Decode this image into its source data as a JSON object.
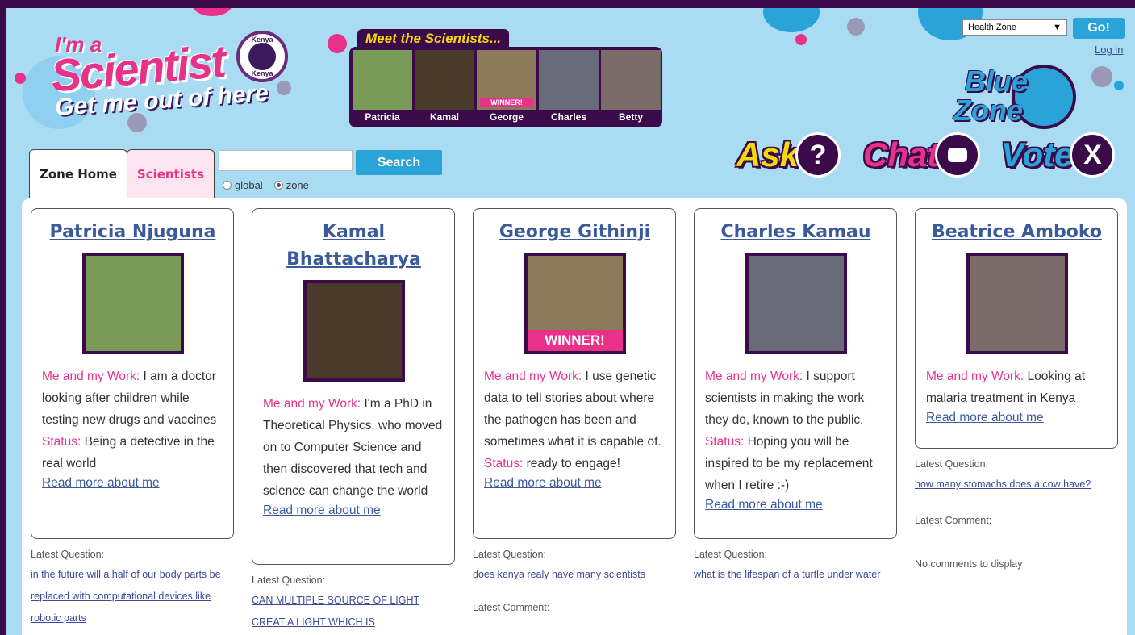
{
  "colors": {
    "accent_pink": "#e8328a",
    "accent_blue": "#2aa3d9",
    "frame_purple": "#3a0a4a",
    "link_blue": "#3a5a9a"
  },
  "header": {
    "logo": {
      "line1": "I'm a",
      "line2": "Scientist",
      "line3": "Get me out of here",
      "seal_top": "Kenya",
      "seal_bottom": "Kenya"
    },
    "meet_title": "Meet the Scientists...",
    "thumbs": [
      {
        "name": "Patricia",
        "color": "#7a9a5a"
      },
      {
        "name": "Kamal",
        "color": "#4a3a2a"
      },
      {
        "name": "George",
        "color": "#8a7a5a",
        "badge": "WINNER!"
      },
      {
        "name": "Charles",
        "color": "#6a6a7a"
      },
      {
        "name": "Betty",
        "color": "#7a6a6a"
      }
    ],
    "zone_select": "Health Zone",
    "go_label": "Go!",
    "login_label": "Log in",
    "zone_badge": {
      "line1": "Blue",
      "line2": "Zone"
    },
    "actions": {
      "ask": "Ask",
      "ask_icon": "?",
      "chat": "Chat",
      "vote": "Vote",
      "vote_icon": "X"
    }
  },
  "tabs": {
    "home": "Zone Home",
    "scientists": "Scientists"
  },
  "search": {
    "button": "Search",
    "opt_global": "global",
    "opt_zone": "zone"
  },
  "cards": [
    {
      "name": "Patricia Njuguna",
      "work_label": "Me and my Work:",
      "work": "I am a doctor looking after children while testing new drugs and vaccines",
      "status_label": "Status:",
      "status": "Being a detective in the real world",
      "more": "Read more about me",
      "latest_q_label": "Latest Question:",
      "latest_q": "in the future will a half of our body parts be replaced with computational devices like robotic parts"
    },
    {
      "name": "Kamal Bhattacharya",
      "work_label": "Me and my Work:",
      "work": "I'm a PhD in Theoretical Physics, who moved on to Computer Science and then discovered that tech and science can change the world",
      "more": "Read more about me",
      "latest_q_label": "Latest Question:",
      "latest_q": "CAN MULTIPLE SOURCE OF LIGHT CREAT A LIGHT WHICH IS"
    },
    {
      "name": "George Githinji",
      "winner": "WINNER!",
      "work_label": "Me and my Work:",
      "work": "I use genetic data to tell stories about where the pathogen has been and sometimes what it is capable of.",
      "status_label": "Status:",
      "status": "ready to engage!",
      "more": "Read more about me",
      "latest_q_label": "Latest Question:",
      "latest_q": "does kenya realy have many scientists",
      "latest_c_label": "Latest Comment:"
    },
    {
      "name": "Charles Kamau",
      "work_label": "Me and my Work:",
      "work": "I support scientists in making the work they do, known to the public.",
      "status_label": "Status:",
      "status": "Hoping you will be inspired to be my replacement when I retire :-)",
      "more": "Read more about me",
      "latest_q_label": "Latest Question:",
      "latest_q": "what is the lifespan of a turtle under water"
    },
    {
      "name": "Beatrice Amboko",
      "work_label": "Me and my Work:",
      "work": "Looking at malaria treatment in Kenya",
      "more": "Read more about me",
      "latest_q_label": "Latest Question:",
      "latest_q": "how many stomachs does a cow have?",
      "latest_c_label": "Latest Comment:",
      "no_comments": "No comments to display"
    }
  ]
}
